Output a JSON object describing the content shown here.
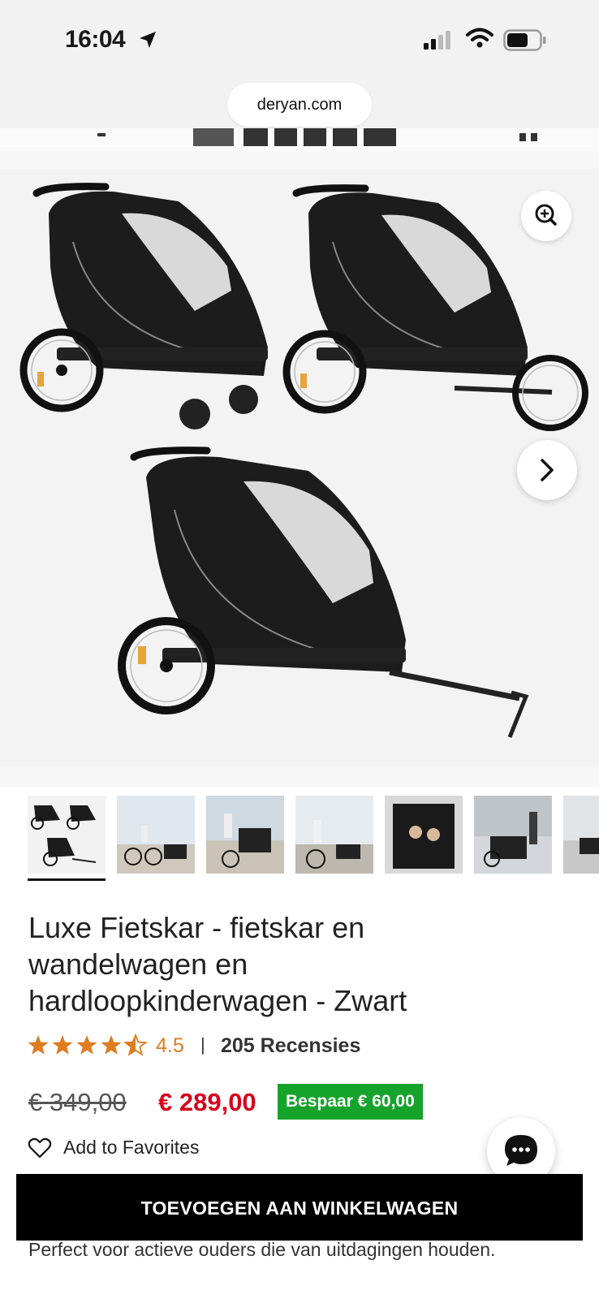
{
  "status_bar": {
    "time": "16:04"
  },
  "browser": {
    "url": "deryan.com"
  },
  "gallery": {
    "zoom_icon": "zoom-in-icon",
    "next_icon": "chevron-right-icon",
    "thumbnail_count": 7
  },
  "product": {
    "title": "Luxe Fietskar - fietskar en wandelwagen en hardloopkinderwagen - Zwart",
    "rating": {
      "stars": 4.5,
      "value_label": "4.5",
      "separator": "|",
      "reviews_label": "205 Recensies"
    },
    "old_price": "€ 349,00",
    "new_price": "€ 289,00",
    "save_badge": "Bespaar  € 60,00",
    "favorites_label": "Add to Favorites",
    "add_to_cart_label": "TOEVOEGEN AAN WINKELWAGEN",
    "tagline": "Perfect voor actieve ouders die van uitdagingen houden."
  },
  "colors": {
    "accent_star": "#e07b1f",
    "price_red": "#d6001c",
    "badge_green": "#16a32b",
    "button_black": "#000000"
  }
}
